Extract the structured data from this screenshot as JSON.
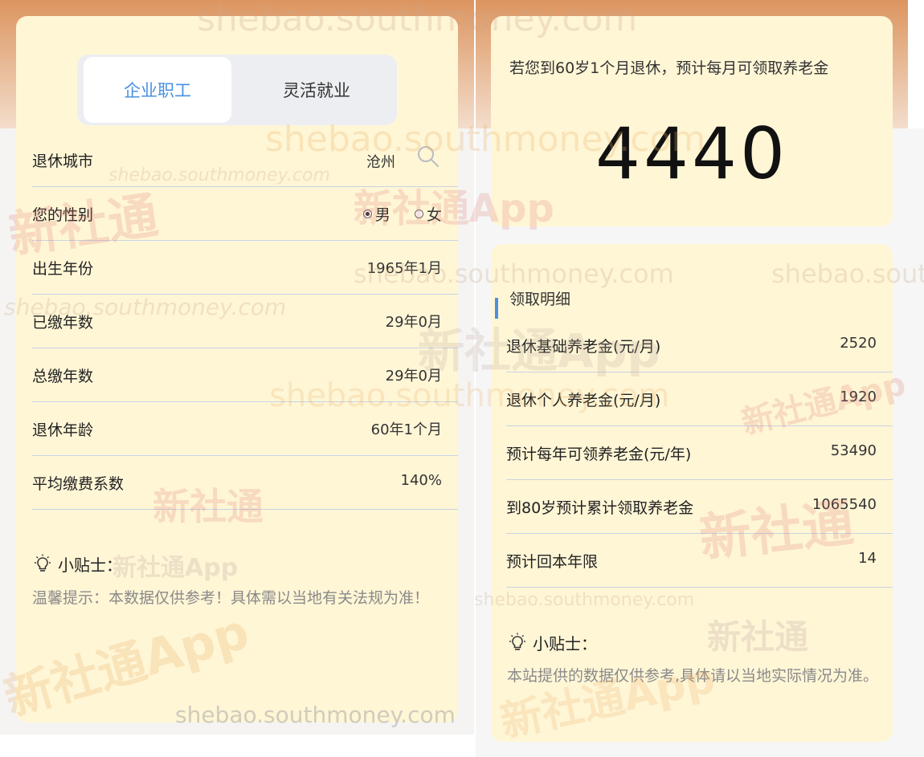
{
  "tabs": {
    "active": "企业职工",
    "inactive": "灵活就业"
  },
  "form": {
    "city_label": "退休城市",
    "city_value": "沧州",
    "gender_label": "您的性别",
    "gender_male": "男",
    "gender_female": "女",
    "gender_selected": "男",
    "birth_label": "出生年份",
    "birth_value": "1965年1月",
    "paid_label": "已缴年数",
    "paid_value": "29年0月",
    "total_label": "总缴年数",
    "total_value": "29年0月",
    "age_label": "退休年龄",
    "age_value": "60年1个月",
    "coef_label": "平均缴费系数",
    "coef_value": "140%"
  },
  "tip_left": {
    "title": "小贴士：",
    "text": "温馨提示：本数据仅供参考！具体需以当地有关法规为准！"
  },
  "result": {
    "description": "若您到60岁1个月退休，预计每月可领取养老金",
    "amount": "4440"
  },
  "details": {
    "title": "领取明细",
    "rows": [
      {
        "label": "退休基础养老金(元/月)",
        "value": "2520"
      },
      {
        "label": "退休个人养老金(元/月)",
        "value": "1920"
      },
      {
        "label": "预计每年可领养老金(元/年)",
        "value": "53490"
      },
      {
        "label": "到80岁预计累计领取养老金",
        "value": "1065540"
      },
      {
        "label": "预计回本年限",
        "value": "14"
      }
    ]
  },
  "tip_right": {
    "title": "小贴士：",
    "text": "本站提供的数据仅供参考,具体请以当地实际情况为准。"
  },
  "watermarks": {
    "site": "shebao.southmoney.com",
    "brand": "新社通App",
    "brand_short": "新社通"
  },
  "colors": {
    "accent": "#4a90e2",
    "card": "#fff6d6",
    "header": "#dc9560"
  }
}
